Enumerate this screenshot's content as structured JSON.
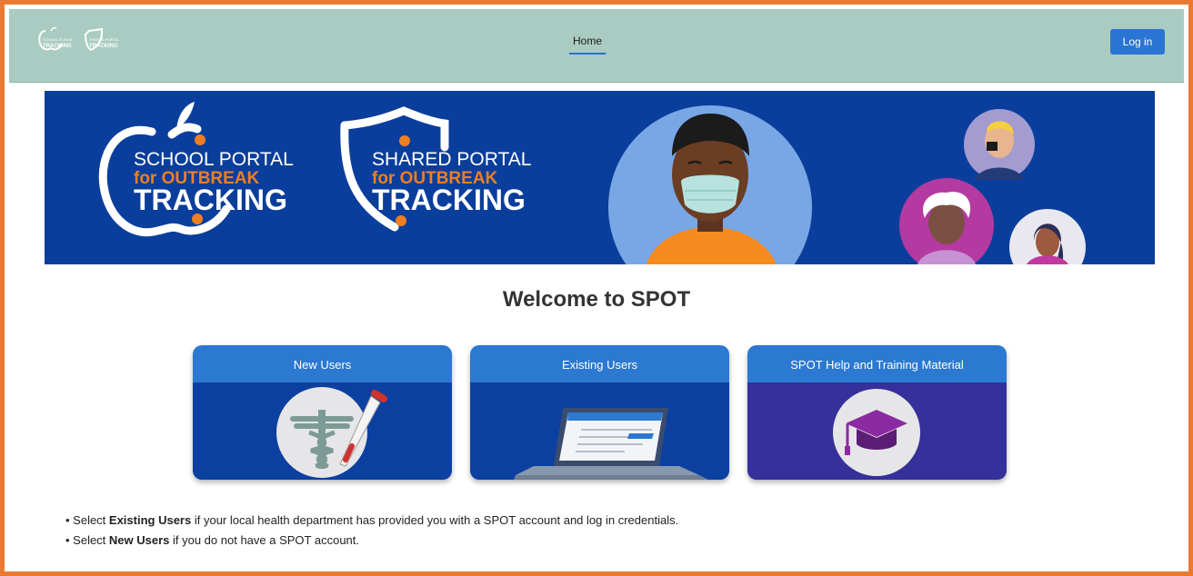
{
  "header": {
    "logos": [
      {
        "line1": "SCHOOL PORTAL",
        "line2": "TRACKING"
      },
      {
        "line1": "SHARED PORTAL",
        "line2": "TRACKING"
      }
    ],
    "nav": [
      {
        "label": "Home"
      }
    ],
    "login_label": "Log in"
  },
  "banner": {
    "logos": [
      {
        "line1": "SCHOOL PORTAL",
        "line2": "for OUTBREAK",
        "line3": "TRACKING"
      },
      {
        "line1": "SHARED PORTAL",
        "line2": "for OUTBREAK",
        "line3": "TRACKING"
      }
    ]
  },
  "main": {
    "title": "Welcome to SPOT",
    "cards": [
      {
        "label": "New Users",
        "icon": "caduceus-syringe-icon"
      },
      {
        "label": "Existing Users",
        "icon": "laptop-icon"
      },
      {
        "label": "SPOT Help and Training Material",
        "icon": "graduation-cap-icon"
      }
    ],
    "notes": [
      {
        "prefix": "• Select ",
        "bold": "Existing Users",
        "suffix": " if your local health department has provided you with a SPOT account and log in credentials."
      },
      {
        "prefix": "• Select ",
        "bold": "New Users",
        "suffix": " if you do not have a SPOT account."
      }
    ]
  },
  "colors": {
    "frame": "#ea7a33",
    "header_bg": "#a9cbc1",
    "accent_blue": "#2a74d3",
    "banner_bg": "#0a3e9c",
    "orange": "#ef7f22",
    "card_body_blue": "#0c40a0",
    "card_body_purple": "#35309a"
  }
}
